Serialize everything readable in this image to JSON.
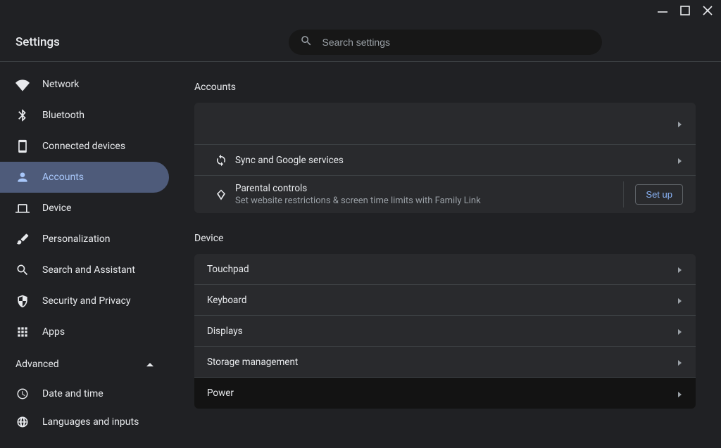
{
  "header": {
    "title": "Settings",
    "search_placeholder": "Search settings"
  },
  "sidebar": {
    "items": [
      {
        "id": "network",
        "label": "Network",
        "icon": "wifi"
      },
      {
        "id": "bluetooth",
        "label": "Bluetooth",
        "icon": "bluetooth"
      },
      {
        "id": "connected",
        "label": "Connected devices",
        "icon": "device-square"
      },
      {
        "id": "accounts",
        "label": "Accounts",
        "icon": "person"
      },
      {
        "id": "device",
        "label": "Device",
        "icon": "laptop"
      },
      {
        "id": "personalization",
        "label": "Personalization",
        "icon": "brush"
      },
      {
        "id": "search",
        "label": "Search and Assistant",
        "icon": "search"
      },
      {
        "id": "security",
        "label": "Security and Privacy",
        "icon": "shield"
      },
      {
        "id": "apps",
        "label": "Apps",
        "icon": "grid"
      }
    ],
    "active": "accounts",
    "advanced_label": "Advanced",
    "advanced_expanded": true,
    "advanced_items": [
      {
        "id": "datetime",
        "label": "Date and time",
        "icon": "clock"
      },
      {
        "id": "languages",
        "label": "Languages and inputs",
        "icon": "globe"
      }
    ]
  },
  "main": {
    "sections": [
      {
        "id": "accounts",
        "title": "Accounts",
        "rows": [
          {
            "type": "blank"
          },
          {
            "type": "iconrow",
            "icon": "sync",
            "primary": "Sync and Google services"
          },
          {
            "type": "iconrow_button",
            "icon": "diamond",
            "primary": "Parental controls",
            "secondary": "Set website restrictions & screen time limits with Family Link",
            "button": "Set up"
          }
        ]
      },
      {
        "id": "device",
        "title": "Device",
        "rows": [
          {
            "type": "simple",
            "primary": "Touchpad"
          },
          {
            "type": "simple",
            "primary": "Keyboard"
          },
          {
            "type": "simple",
            "primary": "Displays"
          },
          {
            "type": "simple",
            "primary": "Storage management"
          },
          {
            "type": "simple",
            "primary": "Power",
            "dark": true
          }
        ]
      }
    ]
  }
}
